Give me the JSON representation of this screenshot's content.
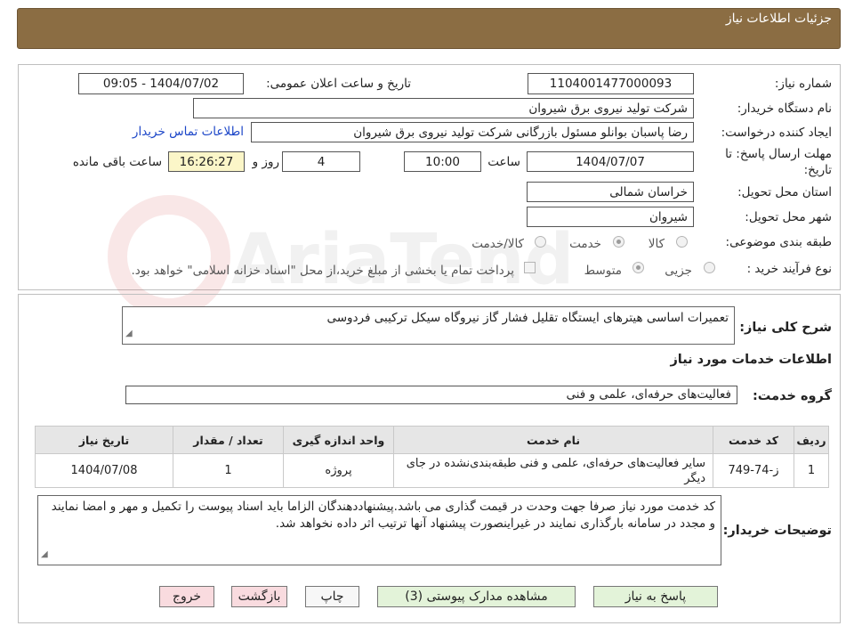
{
  "header": {
    "title": "جزئیات اطلاعات نیاز"
  },
  "form": {
    "need_number": {
      "label": "شماره نیاز:",
      "value": "1104001477000093"
    },
    "announce_datetime": {
      "label": "تاریخ و ساعت اعلان عمومی:",
      "value": "1404/07/02 - 09:05"
    },
    "buyer_org": {
      "label": "نام دستگاه خریدار:",
      "value": "شرکت تولید نیروی برق شیروان"
    },
    "requester": {
      "label": "ایجاد کننده درخواست:",
      "value": "رضا پاسبان بوانلو مسئول بازرگانی شرکت تولید نیروی برق شیروان",
      "contact_link": "اطلاعات تماس خریدار"
    },
    "deadline": {
      "label_line1": "مهلت ارسال پاسخ: تا",
      "label_line2": "تاریخ:",
      "date": "1404/07/07",
      "time_label": "ساعت",
      "time": "10:00",
      "days": "4",
      "days_label": "روز و",
      "remaining": "16:26:27",
      "remaining_label": "ساعت باقی مانده"
    },
    "province": {
      "label": "استان محل تحویل:",
      "value": "خراسان شمالی"
    },
    "city": {
      "label": "شهر محل تحویل:",
      "value": "شیروان"
    },
    "category": {
      "label": "طبقه بندی موضوعی:",
      "options": [
        "کالا",
        "خدمت",
        "کالا/خدمت"
      ],
      "selected": "خدمت"
    },
    "process_type": {
      "label": "نوع فرآیند خرید :",
      "options": [
        "جزیی",
        "متوسط"
      ],
      "selected": "متوسط",
      "payment_note": "پرداخت تمام یا بخشی از مبلغ خرید،از محل \"اسناد خزانه اسلامی\" خواهد بود."
    }
  },
  "summary": {
    "label": "شرح کلی نیاز:",
    "value": "تعمیرات اساسی هیترهای ایستگاه تقلیل فشار گاز نیروگاه سیکل ترکیبی فردوسی"
  },
  "services_section": {
    "title": "اطلاعات خدمات مورد نیاز",
    "group_label": "گروه خدمت:",
    "group_value": "فعالیت‌های حرفه‌ای، علمی و فنی"
  },
  "table": {
    "headers": [
      "ردیف",
      "کد خدمت",
      "نام خدمت",
      "واحد اندازه گیری",
      "تعداد / مقدار",
      "تاریخ نیاز"
    ],
    "rows": [
      [
        "1",
        "ز-74-749",
        "سایر فعالیت‌های حرفه‌ای، علمی و فنی طبقه‌بندی‌نشده در جای دیگر",
        "پروژه",
        "1",
        "1404/07/08"
      ]
    ]
  },
  "buyer_notes": {
    "label": "توضیحات خریدار:",
    "value": "کد خدمت مورد نیاز صرفا جهت وحدت در قیمت گذاری می باشد.پیشنهاددهندگان الزاما باید اسناد پیوست را تکمیل و مهر و امضا نمایند و مجدد در سامانه بارگذاری نمایند در غیراینصورت پیشنهاد آنها ترتیب اثر داده نخواهد شد."
  },
  "buttons": {
    "respond": "پاسخ به نیاز",
    "attachments": "مشاهده مدارک پیوستی (3)",
    "print": "چاپ",
    "back": "بازگشت",
    "exit": "خروج"
  },
  "watermark": "AriaTender.neT"
}
